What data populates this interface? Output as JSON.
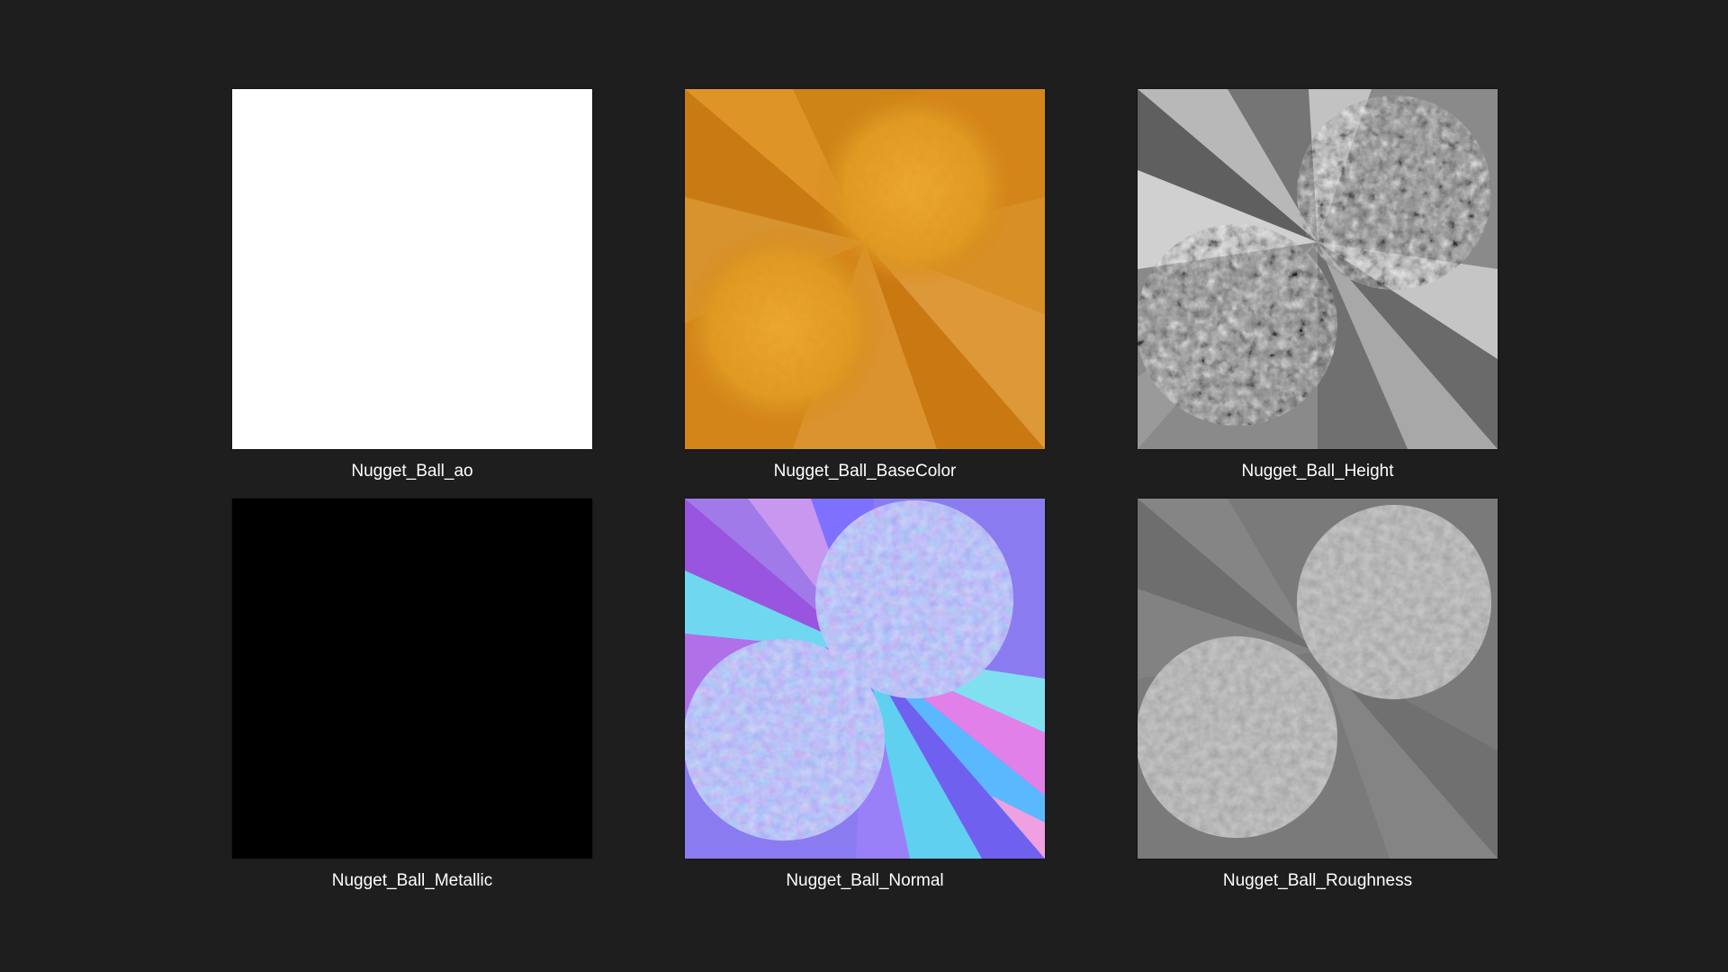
{
  "files": [
    {
      "name": "Nugget_Ball_ao",
      "icon": "ao-map-thumbnail"
    },
    {
      "name": "Nugget_Ball_BaseColor",
      "icon": "basecolor-map-thumbnail"
    },
    {
      "name": "Nugget_Ball_Height",
      "icon": "height-map-thumbnail"
    },
    {
      "name": "Nugget_Ball_Metallic",
      "icon": "metallic-map-thumbnail"
    },
    {
      "name": "Nugget_Ball_Normal",
      "icon": "normal-map-thumbnail"
    },
    {
      "name": "Nugget_Ball_Roughness",
      "icon": "roughness-map-thumbnail"
    }
  ],
  "colors": {
    "background": "#1e1e1e",
    "ao": "#ffffff",
    "metallic": "#000000",
    "basecolor_light": "#f0a520",
    "basecolor_dark": "#c87010",
    "normal_base": "#8080ff"
  }
}
